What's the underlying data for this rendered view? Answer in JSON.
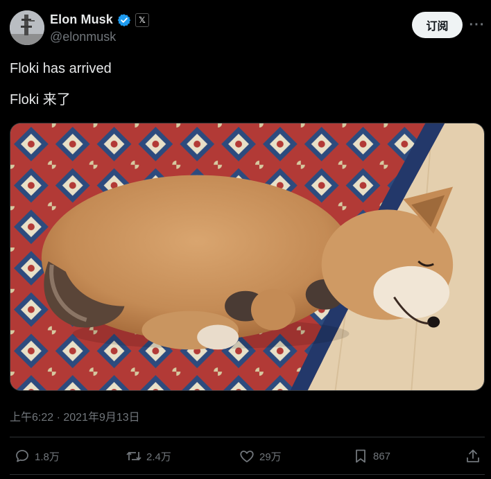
{
  "author": {
    "display_name": "Elon Musk",
    "handle": "@elonmusk",
    "verified_icon": "verified-badge-icon",
    "affiliation_badge": "𝕏"
  },
  "header": {
    "subscribe_label": "订阅",
    "more_label": "···"
  },
  "tweet": {
    "line1": "Floki has arrived",
    "line2": "Floki 来了",
    "timestamp": "上午6:22 · 2021年9月13日"
  },
  "media": {
    "description_icon": "sleeping-shiba-photo"
  },
  "actions": {
    "replies": "1.8万",
    "retweets": "2.4万",
    "likes": "29万",
    "bookmarks": "867"
  },
  "colors": {
    "background": "#000000",
    "text": "#e7e9ea",
    "muted": "#71767b",
    "verified": "#1d9bf0"
  }
}
